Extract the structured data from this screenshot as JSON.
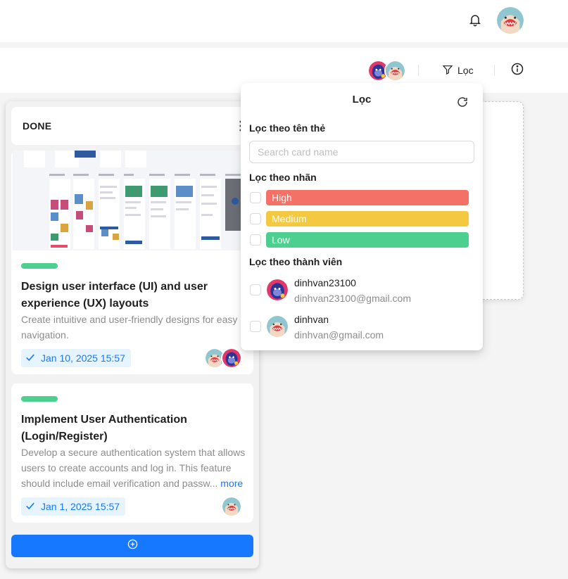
{
  "colors": {
    "primary": "#1677ff",
    "label_green": "#4ccf8f",
    "tag_high": "#f47167",
    "tag_medium": "#f5c842",
    "tag_low": "#4ccf8f"
  },
  "topbar": {
    "icons": [
      "bell-icon",
      "user-avatar"
    ]
  },
  "board_bar": {
    "filter_label": "Lọc",
    "icons": [
      "filter-icon",
      "info-icon"
    ]
  },
  "column": {
    "title": "DONE",
    "cards": [
      {
        "title": "Design user interface (UI) and user experience (UX) layouts",
        "description": "Create intuitive and user-friendly designs for easy navigation.",
        "due": "Jan 10, 2025 15:57"
      },
      {
        "title": "Implement User Authentication (Login/Register)",
        "description": "Develop a secure authentication system that allows users to create accounts and log in. This feature should include email verification and passw...",
        "more": "more",
        "due": "Jan 1, 2025 15:57"
      }
    ]
  },
  "filter_popover": {
    "title": "Lọc",
    "by_name_label": "Lọc theo tên thẻ",
    "search_placeholder": "Search card name",
    "by_label_label": "Lọc theo nhãn",
    "labels": [
      "High",
      "Medium",
      "Low"
    ],
    "by_member_label": "Lọc theo thành viên",
    "members": [
      {
        "name": "dinhvan23100",
        "email": "dinhvan23100@gmail.com"
      },
      {
        "name": "dinhvan",
        "email": "dinhvan@gmail.com"
      }
    ]
  }
}
